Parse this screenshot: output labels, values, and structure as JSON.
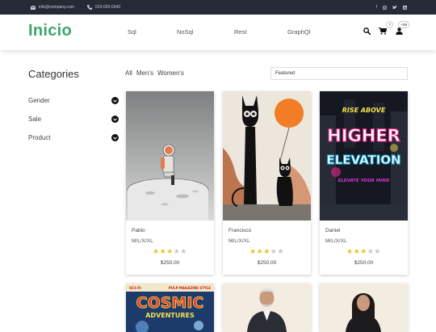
{
  "topbar": {
    "email": "info@company.com",
    "phone": "010-020-0340",
    "social": [
      "facebook-icon",
      "instagram-icon",
      "twitter-icon",
      "linkedin-icon"
    ]
  },
  "header": {
    "logo": "Inicio",
    "nav": [
      "Sql",
      "NoSql",
      "Rest",
      "GraphQl"
    ],
    "cart_count": "7",
    "user_count": "+99"
  },
  "sidebar": {
    "title": "Categories",
    "items": [
      {
        "label": "Gender"
      },
      {
        "label": "Sale"
      },
      {
        "label": "Product"
      }
    ]
  },
  "filters": [
    "All",
    "Men's",
    "Women's"
  ],
  "sort": {
    "selected": "Featured"
  },
  "products": [
    {
      "name": "Pablo",
      "sizes": "M/L/X/XL",
      "rating": 3,
      "max_rating": 5,
      "price": "$250.00"
    },
    {
      "name": "Francisco",
      "sizes": "M/L/X/XL",
      "rating": 3,
      "max_rating": 5,
      "price": "$250.00"
    },
    {
      "name": "Daniel",
      "sizes": "M/L/X/XL",
      "rating": 3,
      "max_rating": 5,
      "price": "$250.00"
    }
  ],
  "poster_texts": {
    "daniel_top": "RISE ABOVE",
    "daniel_main_1": "HIGHER",
    "daniel_main_2": "ELEVATION",
    "daniel_bottom": "ELEVATE YOUR MIND",
    "cosmic_tag_left": "SCI-FI",
    "cosmic_tag_right": "PULP MAGAZINE STYLE",
    "cosmic_main": "COSMIC",
    "cosmic_sub": "ADVENTURES"
  },
  "colors": {
    "logo": "#3ea66b",
    "topbar_bg": "#252a36",
    "star_on": "#e6c428",
    "star_off": "#c7c7c7"
  }
}
